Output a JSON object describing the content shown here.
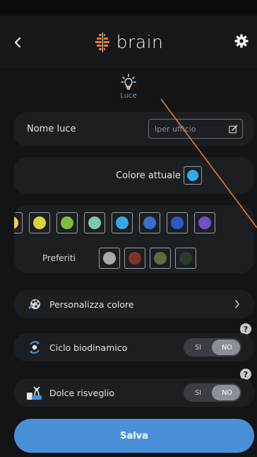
{
  "header": {
    "title": "brain",
    "back_icon": "chevron-left-icon",
    "settings_icon": "gear-icon",
    "logo_icon": "brain-logo-icon"
  },
  "light_type": {
    "label": "Luce",
    "icon": "lightbulb-icon",
    "accent_color": "#4ea3e0"
  },
  "name_field": {
    "label": "Nome luce",
    "placeholder": "Iper ufficio",
    "edit_icon": "edit-icon"
  },
  "current_color": {
    "label": "Colore attuale",
    "color": "#35a9e8"
  },
  "palette": {
    "colors": [
      "#e3d64a",
      "#d7d53c",
      "#7cbf3e",
      "#7fc8ad",
      "#35a9e8",
      "#3a6fc9",
      "#2e58c6",
      "#6b54c2"
    ],
    "favorites_label": "Preferiti",
    "favorites": [
      "#a9a9a9",
      "#7d3427",
      "#5e6d3c",
      "#2a3d2b"
    ]
  },
  "options": {
    "custom_color": {
      "label": "Personalizza colore",
      "icon": "palette-icon",
      "chevron_icon": "chevron-right-icon"
    },
    "biodynamic_cycle": {
      "label": "Ciclo biodinamico",
      "icon": "cycle-icon",
      "yes": "SI",
      "no": "NO",
      "value": "NO",
      "help": "?"
    },
    "gentle_wakeup": {
      "label": "Dolce risveglio",
      "icon": "wakeup-icon",
      "yes": "SI",
      "no": "NO",
      "value": "NO",
      "help": "?"
    }
  },
  "save_button": {
    "label": "Salva"
  },
  "colors": {
    "background": "#121416",
    "card": "#1c1f22",
    "button": "#4a90d9",
    "annotation_line": "#e07b2a"
  }
}
